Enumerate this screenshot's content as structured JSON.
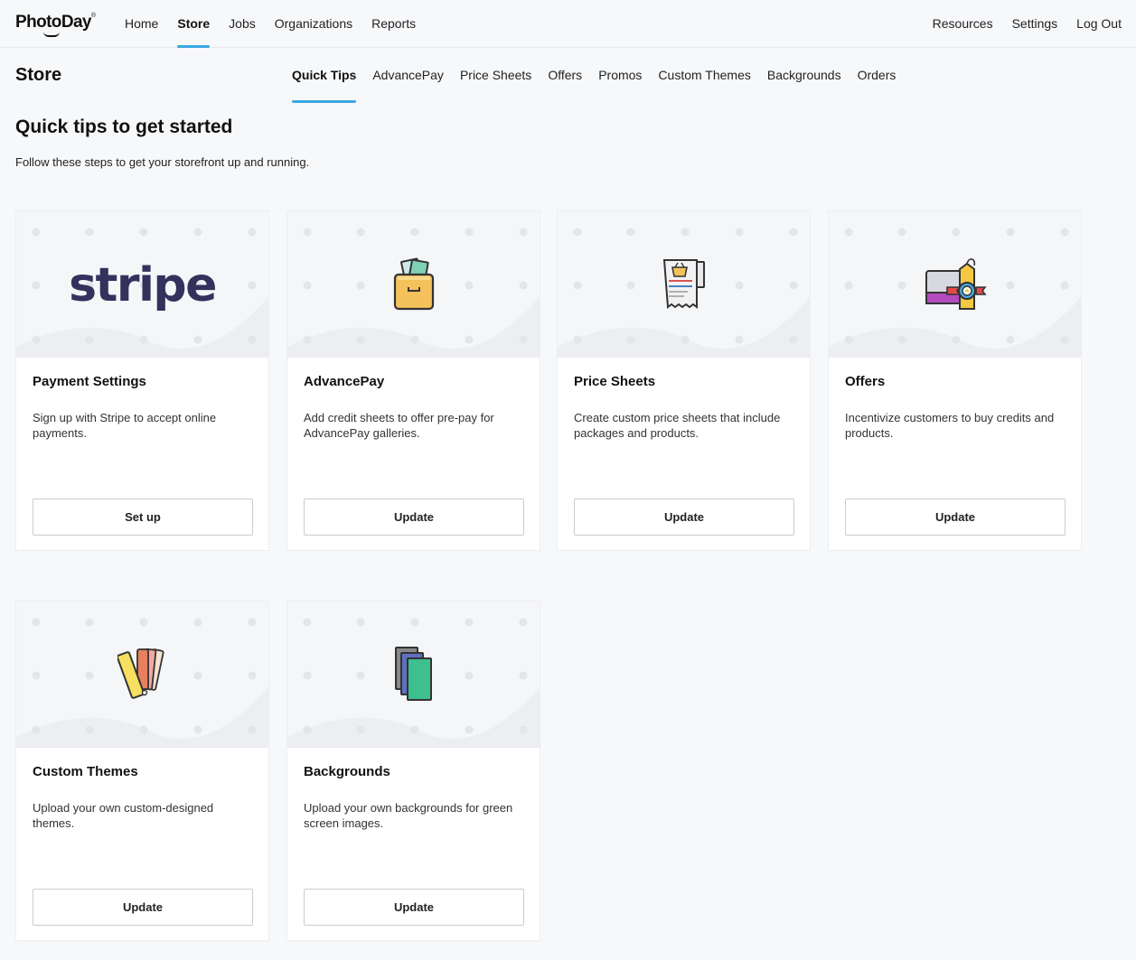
{
  "brand": {
    "name": "PhotoDay",
    "trademark": "®"
  },
  "topnav": {
    "left": [
      "Home",
      "Store",
      "Jobs",
      "Organizations",
      "Reports"
    ],
    "right": [
      "Resources",
      "Settings",
      "Log Out"
    ],
    "active": "Store",
    "accent_color": "#3aa8e0"
  },
  "page": {
    "title": "Store",
    "tabs": [
      "Quick Tips",
      "AdvancePay",
      "Price Sheets",
      "Offers",
      "Promos",
      "Custom Themes",
      "Backgrounds",
      "Orders"
    ],
    "active_tab": "Quick Tips"
  },
  "section": {
    "title": "Quick tips to get started",
    "subtitle": "Follow these steps to get your storefront up and running."
  },
  "cards": [
    {
      "title": "Payment Settings",
      "desc": "Sign up with Stripe to accept online payments.",
      "button": "Set up",
      "icon": "stripe-logo",
      "logo_text": "stripe"
    },
    {
      "title": "AdvancePay",
      "desc": "Add credit sheets to offer pre-pay for AdvancePay galleries.",
      "button": "Update",
      "icon": "wallet-icon"
    },
    {
      "title": "Price Sheets",
      "desc": "Create custom price sheets that include packages and products.",
      "button": "Update",
      "icon": "price-sheet-icon"
    },
    {
      "title": "Offers",
      "desc": "Incentivize customers to buy credits and products.",
      "button": "Update",
      "icon": "offer-tag-icon"
    },
    {
      "title": "Custom Themes",
      "desc": "Upload your own custom-designed themes.",
      "button": "Update",
      "icon": "color-swatch-icon"
    },
    {
      "title": "Backgrounds",
      "desc": "Upload your own backgrounds for green screen images.",
      "button": "Update",
      "icon": "backgrounds-icon"
    }
  ]
}
